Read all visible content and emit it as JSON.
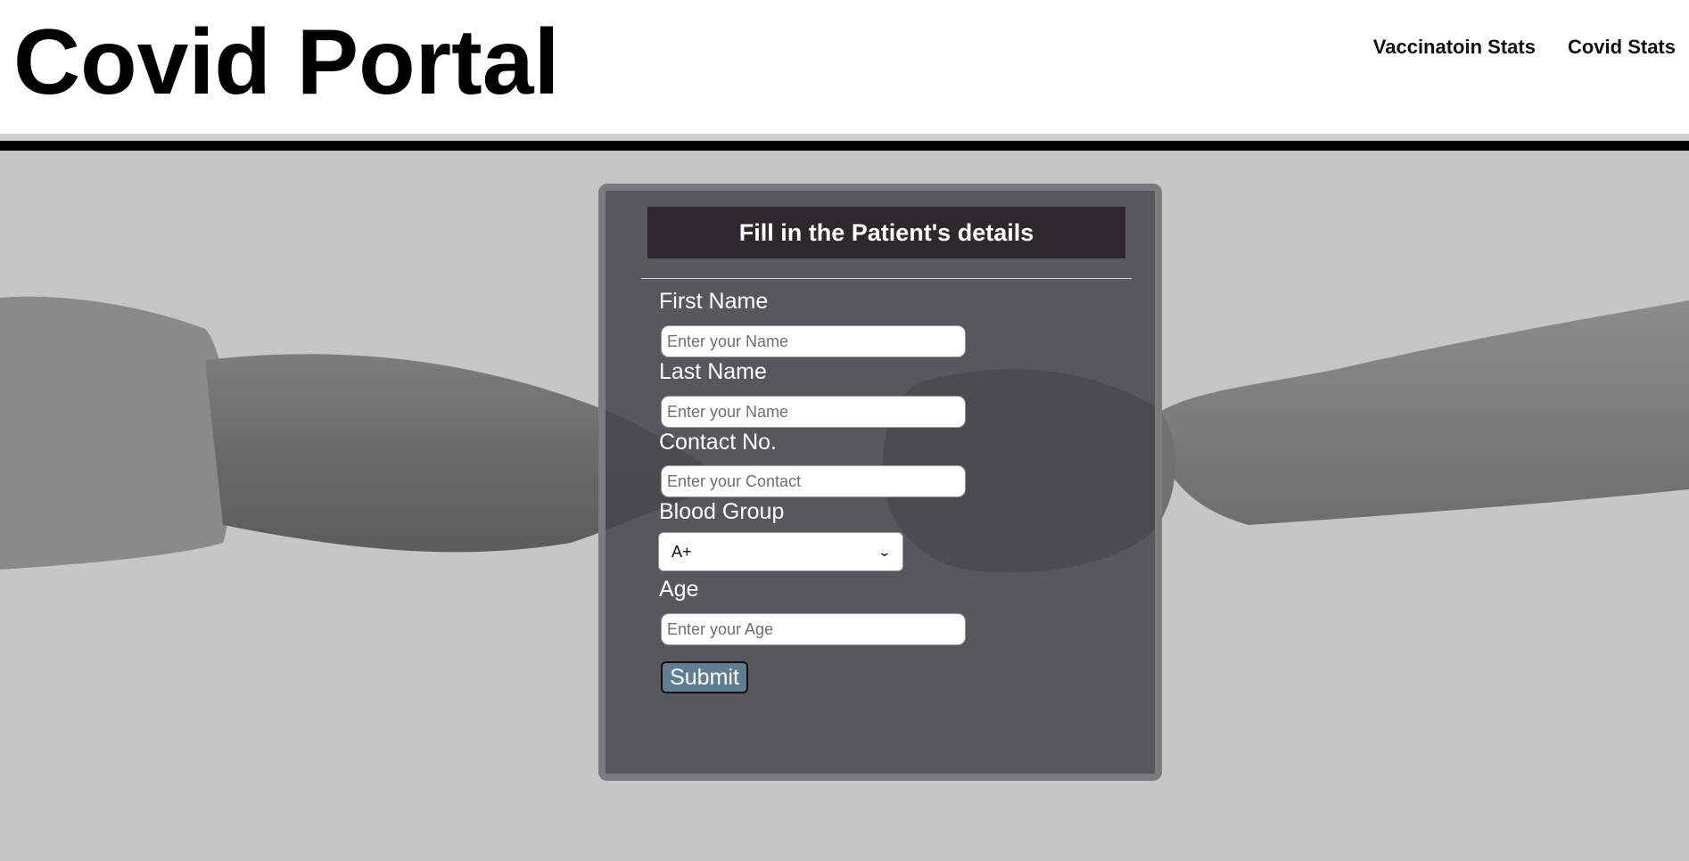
{
  "header": {
    "title": "Covid Portal",
    "nav": [
      {
        "label": "Vaccinatoin Stats"
      },
      {
        "label": "Covid Stats"
      }
    ]
  },
  "form": {
    "heading": "Fill in the Patient's details",
    "fields": {
      "first_name": {
        "label": "First Name",
        "placeholder": "Enter your Name",
        "value": ""
      },
      "last_name": {
        "label": "Last Name",
        "placeholder": "Enter your Name",
        "value": ""
      },
      "contact": {
        "label": "Contact No.",
        "placeholder": "Enter your Contact",
        "value": ""
      },
      "blood_group": {
        "label": "Blood Group",
        "selected": "A+"
      },
      "age": {
        "label": "Age",
        "placeholder": "Enter your Age",
        "value": ""
      }
    },
    "submit_label": "Submit"
  },
  "colors": {
    "card_background": "#46464a",
    "card_border": "#7b7b7d",
    "heading_background": "#2c282b",
    "submit_background": "#5f7e92",
    "page_background": "#c6c6c6"
  },
  "icons": {
    "select_arrow": "chevron-down-icon"
  }
}
